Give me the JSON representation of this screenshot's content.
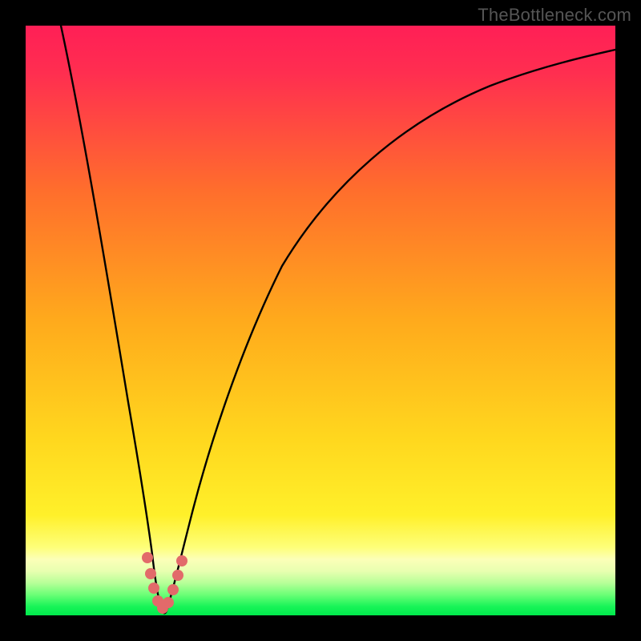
{
  "watermark": "TheBottleneck.com",
  "colors": {
    "black": "#000000",
    "pink_top": "#ff1f56",
    "orange": "#ff9a1f",
    "yellow": "#ffe024",
    "pale_yellow": "#feff88",
    "green": "#00ef4f",
    "curve": "#000000",
    "marker": "#e26a6a"
  },
  "chart_data": {
    "type": "line",
    "title": "",
    "xlabel": "",
    "ylabel": "",
    "xlim": [
      0,
      100
    ],
    "ylim": [
      0,
      100
    ],
    "x": [
      0,
      2,
      4,
      6,
      8,
      10,
      12,
      14,
      16,
      18,
      19,
      20,
      21,
      22,
      23,
      24,
      26,
      28,
      30,
      34,
      38,
      42,
      46,
      50,
      55,
      60,
      65,
      70,
      75,
      80,
      85,
      90,
      95,
      100
    ],
    "y": [
      100,
      94,
      86,
      78,
      70,
      61,
      52,
      42,
      32,
      20,
      13,
      5,
      0,
      3,
      10,
      17,
      28,
      37,
      45,
      56,
      64,
      70,
      75,
      79,
      82.5,
      85.5,
      88,
      90,
      91.7,
      93.2,
      94.5,
      95.7,
      96.7,
      97.5
    ],
    "minimum_x": 21,
    "minimum_y": 0,
    "marker_points_x": [
      18.5,
      19.2,
      20.0,
      20.7,
      21.3,
      22.0,
      22.8,
      23.5
    ],
    "marker_points_y": [
      12,
      8,
      4,
      1,
      1,
      4,
      8,
      12
    ],
    "annotations": [],
    "legend": []
  }
}
